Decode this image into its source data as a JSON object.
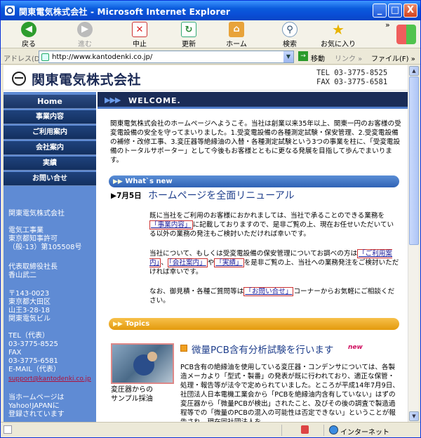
{
  "window": {
    "title": "関東電気株式会社 - Microsoft Internet Explorer",
    "min": "_",
    "max": "□",
    "close": "X"
  },
  "toolbar": {
    "back": "戻る",
    "forward": "進む",
    "stop": "中止",
    "refresh": "更新",
    "home": "ホーム",
    "search": "検索",
    "favorites": "お気に入り",
    "more": "»"
  },
  "address": {
    "label": "アドレス(D)",
    "url": "http://www.kantodenki.co.jp/",
    "go": "移動",
    "links": "リンク »",
    "file": "ファイル(F) »"
  },
  "site": {
    "company_name": "関東電気株式会社",
    "tel": "TEL 03-3775-8525",
    "fax": "FAX 03-3775-6581"
  },
  "nav": [
    "Home",
    "事業内容",
    "ご利用案内",
    "会社案内",
    "実績",
    "お問い合せ"
  ],
  "side": {
    "name": "関東電気株式会社",
    "business": "電気工事業",
    "license1": "東京都知事許可",
    "license2": "（般-13）第105508号",
    "rep_title": "代表取締役社長",
    "rep_name": "香山武二",
    "zip": "〒143-0023",
    "addr1": "東京都大田区",
    "addr2": "山王3-28-18",
    "bldg": "関東電気ビル",
    "tel_label": "TEL（代表）",
    "tel": "03-3775-8525",
    "fax_label": "FAX",
    "fax": "03-3775-6581",
    "email_label": "E-MAIL（代表）",
    "email": "support@kantodenki.co.jp",
    "notice1": "当ホームページは",
    "notice2": "Yahoo!JAPANに",
    "notice3": "登録されています"
  },
  "welcome": {
    "arrows": "▶▶▶",
    "title": "WELCOME."
  },
  "intro": "関東電気株式会社のホームページへようこそ。当社は創業以来35年以上、関東一円のお客様の受変電設備の安全を守ってまいりました。1.受変電設備の各種測定試験・保安管理、2.受変電設備の補修・改修工事、3.変圧器等絶縁油の入替・各種測定試験という3つの事業を柱に、「受変電設備のトータルサポーター」として今後もお客様とともに更なる発展を目指して歩んでまいります。",
  "whats_new": {
    "label": "What`s new",
    "icon": "▶▶",
    "date": "▶7月5日",
    "headline": "ホームページを全面リニューアル",
    "p1_before": "既に当社をご利用のお客様におかれましては、当社で承ることのできる業務を",
    "p1_link": "「事業内容」",
    "p1_after": "に記載しておりますので、是非ご覧の上、現在お任せいただいている以外の業務の発注もご検討いただければ幸いです。",
    "p2_before": "当社について、もしくは受変電設備の保安管理についてお調べの方は",
    "p2_link1": "「ご利用案内」",
    "p2_sep": "、",
    "p2_link2": "「会社案内」",
    "p2_mid": "や",
    "p2_link3": "「実績」",
    "p2_after": "を是非ご覧の上、当社への業務発注をご検討いただければ幸いです。",
    "p3_before": "なお、御見積・各種ご質問等は",
    "p3_link": "「お問い合せ」",
    "p3_after": "コーナーからお気軽にご相談ください。"
  },
  "topics": {
    "label": "Topics",
    "icon": "▶▶",
    "headline": "微量PCB含有分析試験を行います",
    "new": "new",
    "caption1": "変圧器からの",
    "caption2": "サンプル採油",
    "body": "PCB含有の絶縁油を使用している変圧器・コンデンサについては、各製造メーカより「型式・製番」の発表が既に行われており、適正な保管・処理・報告等が法令で定められていました。ところが平成14年7月9日、社団法人日本電機工業会から「PCBを絶縁油内含有していない」はずの変圧器から「微量PCBが検出」されたこと、及びその後の調査で製造過程等での「微量のPCBの混入の可能性は否定できない」ということが報告され、現在同社団法人を"
  },
  "status": {
    "zone": "インターネット"
  }
}
